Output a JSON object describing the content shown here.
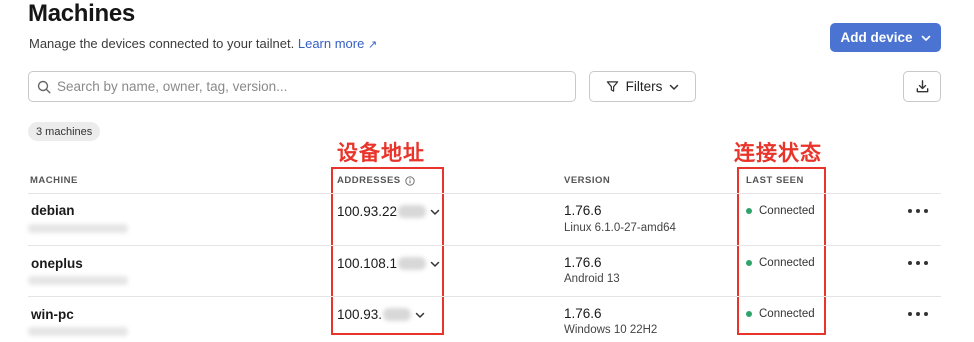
{
  "header": {
    "title": "Machines",
    "subtitle": "Manage the devices connected to your tailnet.",
    "learn_more": "Learn more",
    "learn_more_arrow": "↗",
    "add_device_label": "Add device"
  },
  "toolbar": {
    "search_placeholder": "Search by name, owner, tag, version...",
    "filters_label": "Filters"
  },
  "count_badge": "3 machines",
  "annotations": {
    "addresses_note": "设备地址",
    "status_note": "连接状态",
    "color": "#e8342a"
  },
  "columns": {
    "machine": "MACHINE",
    "addresses": "ADDRESSES",
    "version": "VERSION",
    "last_seen": "LAST SEEN"
  },
  "machines": [
    {
      "name": "debian",
      "address": "100.93.22",
      "version": "1.76.6",
      "os": "Linux 6.1.0-27-amd64",
      "status": "Connected"
    },
    {
      "name": "oneplus",
      "address": "100.108.1",
      "version": "1.76.6",
      "os": "Android 13",
      "status": "Connected"
    },
    {
      "name": "win-pc",
      "address": "100.93.",
      "version": "1.76.6",
      "os": "Windows 10 22H2",
      "status": "Connected"
    }
  ],
  "colors": {
    "accent": "#4b74d2",
    "link": "#3560c4",
    "status_connected": "#2fa46a"
  }
}
